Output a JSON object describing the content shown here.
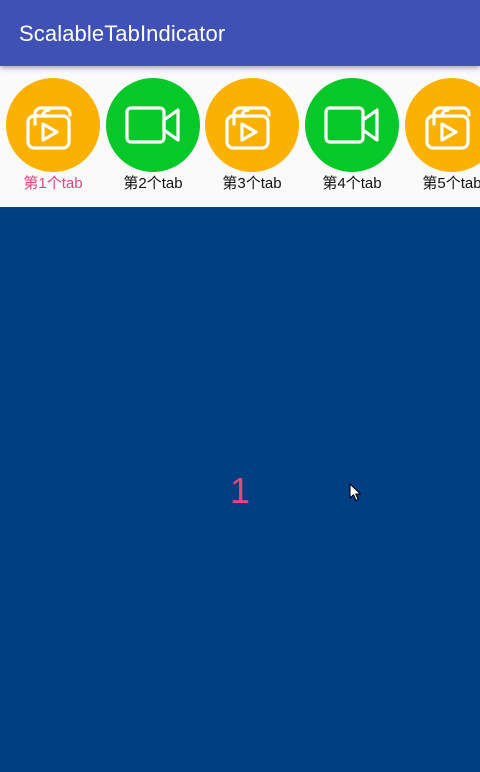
{
  "app": {
    "title": "ScalableTabIndicator"
  },
  "colors": {
    "app_bar": "#3f51b5",
    "tab_strip_bg": "#fafafa",
    "content_bg": "#013e82",
    "accent": "#e8467c",
    "amber": "#fbb100",
    "green": "#06c829"
  },
  "tabs": [
    {
      "label": "第1个tab",
      "icon": "slideshow-icon",
      "color": "#fbb100",
      "selected": true
    },
    {
      "label": "第2个tab",
      "icon": "video-camera-icon",
      "color": "#06c829",
      "selected": false
    },
    {
      "label": "第3个tab",
      "icon": "slideshow-icon",
      "color": "#fbb100",
      "selected": false
    },
    {
      "label": "第4个tab",
      "icon": "video-camera-icon",
      "color": "#06c829",
      "selected": false
    },
    {
      "label": "第5个tab",
      "icon": "slideshow-icon",
      "color": "#fbb100",
      "selected": false
    }
  ],
  "content": {
    "page_number": "1"
  }
}
